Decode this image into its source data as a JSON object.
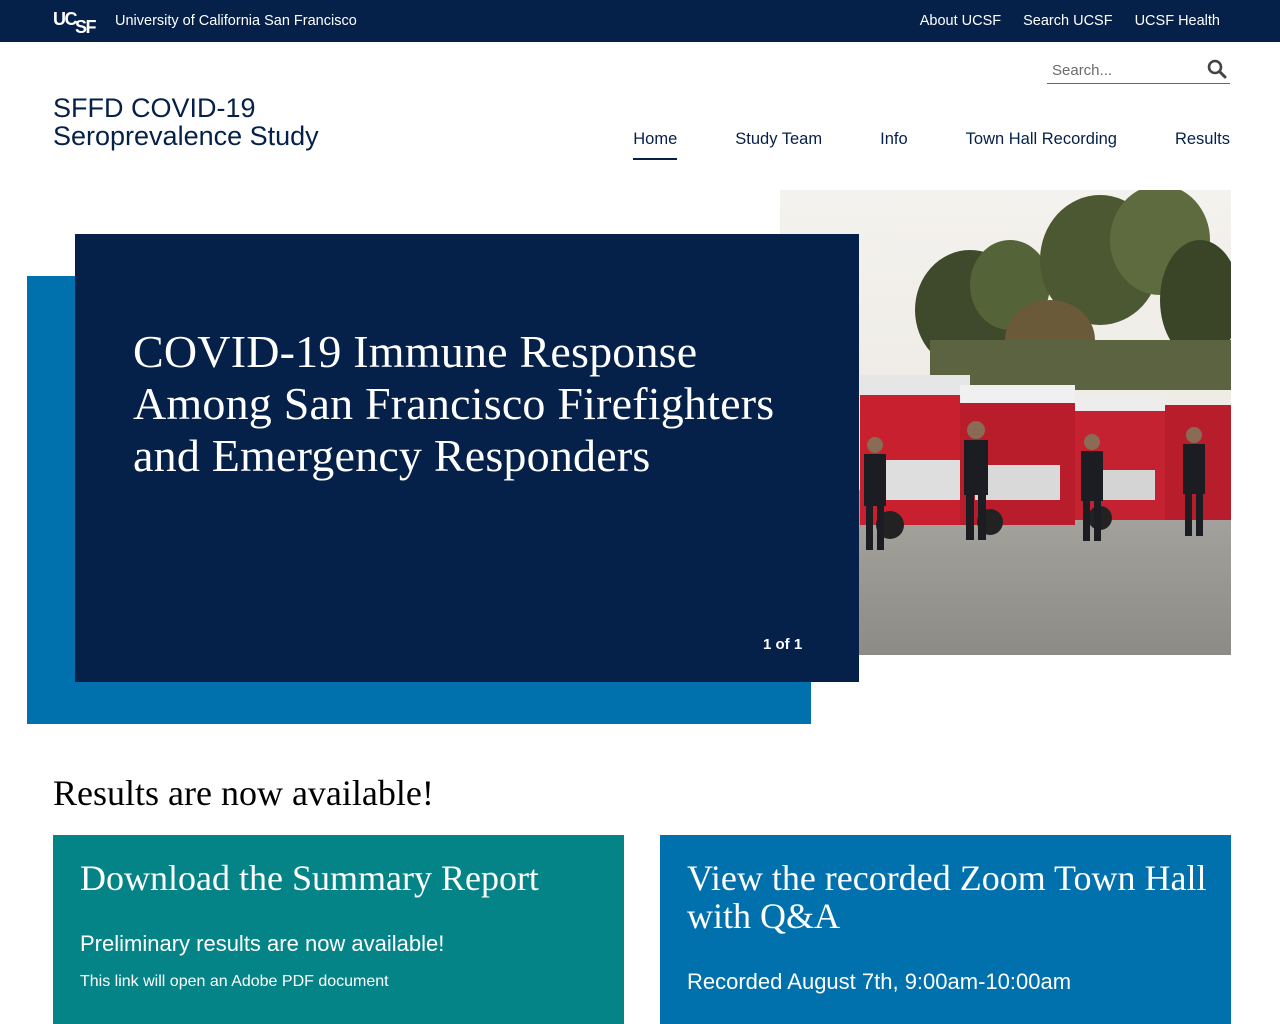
{
  "topbar": {
    "logo_text": "UCSF",
    "university_name": "University of California San Francisco",
    "links": [
      "About UCSF",
      "Search UCSF",
      "UCSF Health"
    ]
  },
  "search": {
    "placeholder": "Search..."
  },
  "site_title": {
    "line1": "SFFD COVID-19",
    "line2": "Seroprevalence Study"
  },
  "nav": {
    "items": [
      "Home",
      "Study Team",
      "Info",
      "Town Hall Recording",
      "Results"
    ],
    "active": "Home"
  },
  "hero": {
    "heading": "COVID-19 Immune Response Among San Francisco Firefighters and Emergency Responders",
    "pager": "1 of 1"
  },
  "results": {
    "heading": "Results are now available!",
    "cards": [
      {
        "title": "Download the Summary Report",
        "text": "Preliminary results are now available!",
        "note": "This link will open an Adobe PDF document",
        "color": "#058488"
      },
      {
        "title": "View the recorded Zoom Town Hall with Q&A",
        "text": "Recorded August 7th, 9:00am-10:00am",
        "color": "#0071ad"
      }
    ]
  },
  "colors": {
    "navy": "#052049",
    "blue": "#0071ad",
    "teal": "#058488"
  }
}
